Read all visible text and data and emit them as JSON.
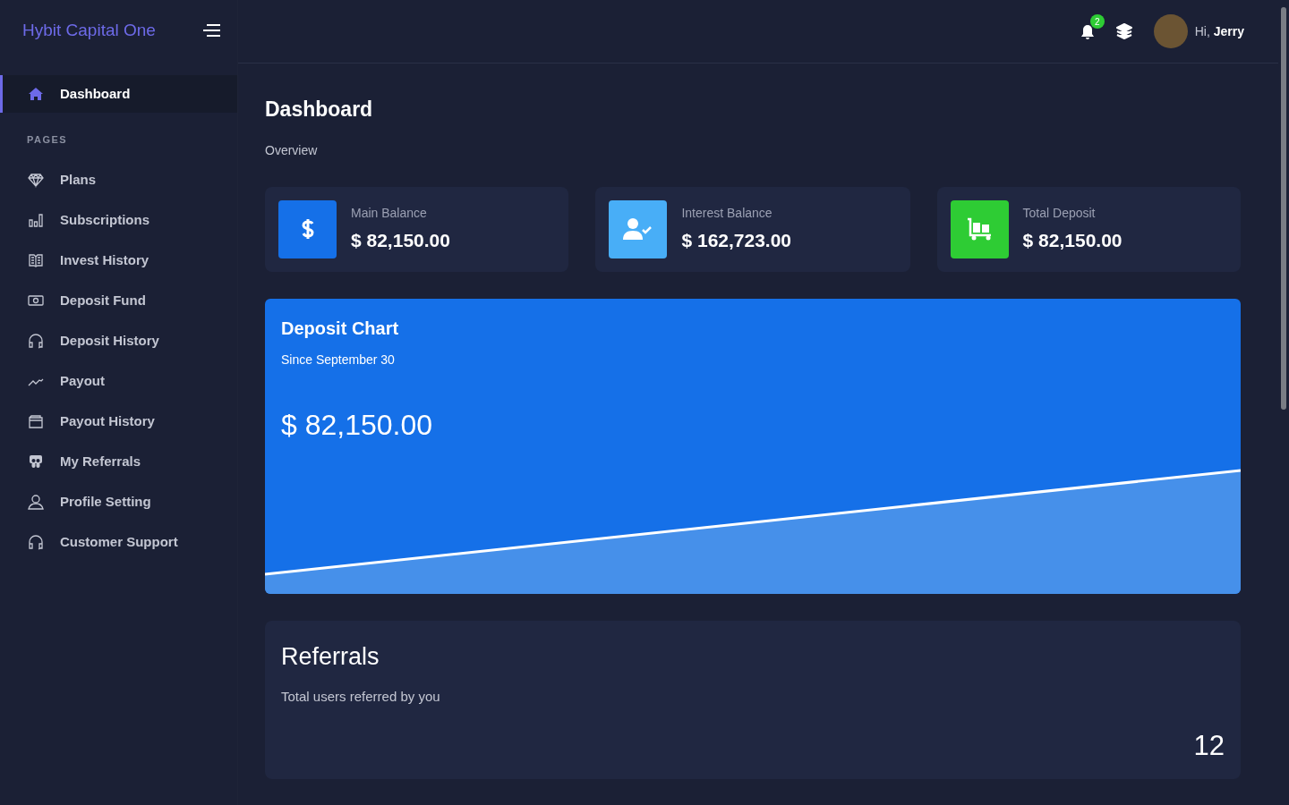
{
  "brand": "Hybit Capital One",
  "sidebar": {
    "items": [
      {
        "label": "Dashboard",
        "selected": true
      }
    ],
    "section": "PAGES",
    "pages": [
      {
        "label": "Plans",
        "selected": false
      },
      {
        "label": "Subscriptions",
        "selected": false
      },
      {
        "label": "Invest History",
        "selected": false
      },
      {
        "label": "Deposit Fund",
        "selected": false
      },
      {
        "label": "Deposit History",
        "selected": false
      },
      {
        "label": "Payout",
        "selected": false
      },
      {
        "label": "Payout History",
        "selected": false
      },
      {
        "label": "My Referrals",
        "selected": false
      },
      {
        "label": "Profile Setting",
        "selected": false
      },
      {
        "label": "Customer Support",
        "selected": false
      }
    ]
  },
  "topbar": {
    "notification_count": "2",
    "greeting": "Hi,",
    "user": "Jerry"
  },
  "page": {
    "title": "Dashboard",
    "subtitle": "Overview"
  },
  "stats": [
    {
      "label": "Main Balance",
      "value": "$ 82,150.00",
      "color": "#1570e8"
    },
    {
      "label": "Interest Balance",
      "value": "$ 162,723.00",
      "color": "#48aef7"
    },
    {
      "label": "Total Deposit",
      "value": "$ 82,150.00",
      "color": "#2ecc34"
    }
  ],
  "deposit_chart": {
    "title": "Deposit Chart",
    "subtitle": "Since September 30",
    "amount": "$ 82,150.00"
  },
  "referrals": {
    "title": "Referrals",
    "subtitle": "Total users referred by you",
    "count": "12"
  }
}
